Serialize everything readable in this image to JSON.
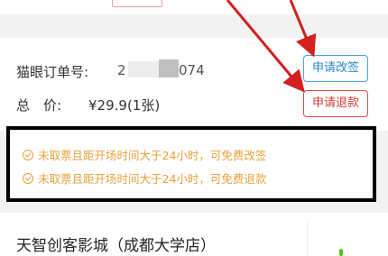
{
  "top": {
    "tag_text": ""
  },
  "order": {
    "order_no_label": "猫眼订单号:",
    "order_no_prefix": "2",
    "order_no_suffix": "074",
    "total_label": "总　价:",
    "total_value": "¥29.9(1张)"
  },
  "buttons": {
    "change_label": "申请改签",
    "refund_label": "申请退款"
  },
  "notices": [
    "未取票且距开场时间大于24小时，可免费改签",
    "未取票且距开场时间大于24小时，可免费退款"
  ],
  "cinema": {
    "name": "天智创客影城（成都大学店）"
  },
  "colors": {
    "change_accent": "#2a86c8",
    "refund_accent": "#d93a3a",
    "notice_text": "#e6a23c",
    "annotation_arrow": "#d32020",
    "highlight_box": "#000000"
  },
  "icons": {
    "notice_icon": "check-circle-icon"
  }
}
